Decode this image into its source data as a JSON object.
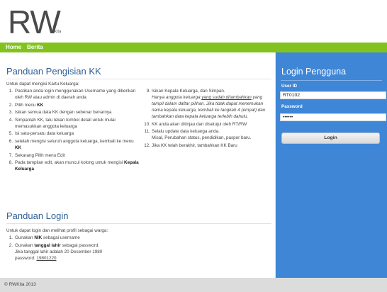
{
  "header": {
    "logo": "RW",
    "logo_sub": "kita"
  },
  "nav": {
    "items": [
      "Home",
      "Berita"
    ]
  },
  "main": {
    "panduan_kk": {
      "title": "Panduan Pengisian KK",
      "intro": "Untuk dapat mengisi Kartu Keluarga:",
      "left_items": [
        {
          "num": "1.",
          "text": "Pastikan anda login menggunakan Username yang diberikan oleh RW atau admin di daerah anda"
        },
        {
          "num": "2.",
          "text_pre": "Pilih menu ",
          "bold": "KK"
        },
        {
          "num": "3.",
          "text": "Isikan semua data KK dengan sebenar benarnya"
        },
        {
          "num": "4.",
          "text": "Simpanlah KK, lalu tekan tombol detail untuk mulai memasukkan anggota keluarga"
        },
        {
          "num": "5.",
          "text": "Isi satu-persatu data keluarga"
        },
        {
          "num": "6.",
          "text_pre": "setelah mengisi seluruh anggota keluarga, kembali ke menu ",
          "bold": "KK"
        },
        {
          "num": "7.",
          "text": "Sekarang Pilih menu Edit"
        },
        {
          "num": "8.",
          "text_pre": "Pada tampilan edit, akan muncul kolong untuk mengisi ",
          "bold": "Kepala Keluarga"
        }
      ],
      "right_items": [
        {
          "num": "9.",
          "text": "Isikan Kepala Keluarga, dan Simpan.",
          "note_pre": "Hanya anggota keluarga ",
          "note_link": "yang sudah ditambahkan",
          "note_post": " yang tampil dalam daftar pilihan. Jika tidak dapat menemukan nama kepala keluarga, kembali ke langkah 4 (empat) dan tambahkan data kepala keluarga terlebih dahulu."
        },
        {
          "num": "10.",
          "text": "KK anda akan ditinjau dan disetujui oleh RT/RW"
        },
        {
          "num": "11.",
          "text": "Selalu update data keluarga anda.",
          "sub": "Misal, Perubahan status, pendidikan, paspor baru."
        },
        {
          "num": "12.",
          "text": "Jika KK telah berakhir, tambahkan KK Baru"
        }
      ]
    },
    "panduan_login": {
      "title": "Panduan Login",
      "intro": "Untuk dapat login dan melihat profil sebagai warga:",
      "items": [
        {
          "num": "1.",
          "text_pre": "Gunakan ",
          "bold": "NIK",
          "text_post": " sebagai username"
        },
        {
          "num": "2.",
          "text_pre": "Gunakan ",
          "bold": "tanggal lahir",
          "text_post": " sebagai password.",
          "line2": "Jika tanggal lahir adalah 20 Desember 1980",
          "line3_pre": "password: ",
          "line3_link": "19801220"
        }
      ]
    }
  },
  "sidebar": {
    "title": "Login Pengguna",
    "user_label": "User ID",
    "user_value": "RT0102",
    "pass_label": "Password",
    "pass_value": "••••••",
    "login_button": "Login"
  },
  "footer": {
    "text": "© RWKita 2013"
  },
  "colors": {
    "nav_green": "#82c21f",
    "sidebar_blue": "#3f86d6",
    "heading_blue": "#2f5f96"
  }
}
